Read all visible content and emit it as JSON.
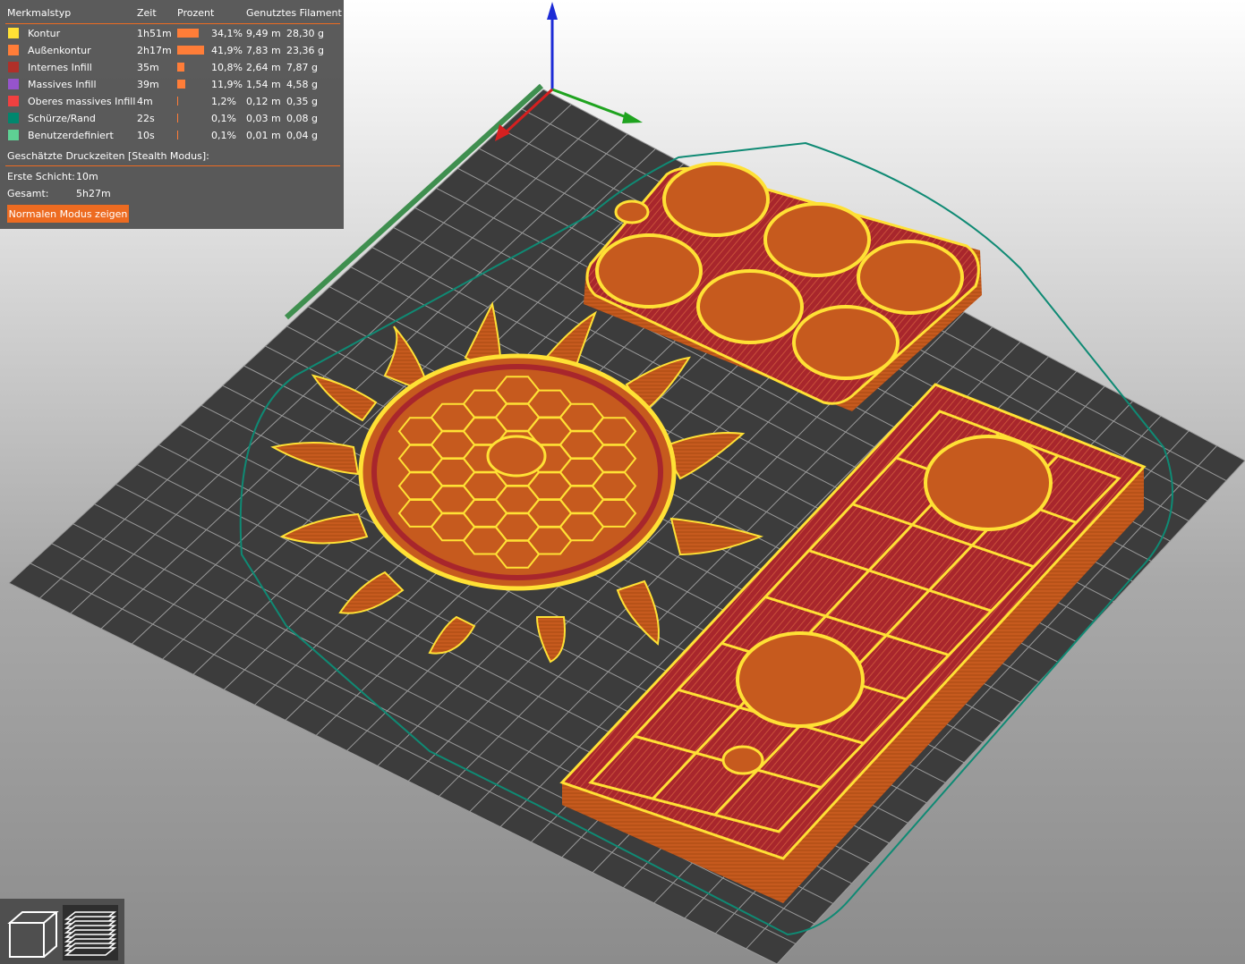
{
  "legend": {
    "headers": {
      "feature_type": "Merkmalstyp",
      "time": "Zeit",
      "percent": "Prozent",
      "filament": "Genutztes Filament"
    },
    "rows": [
      {
        "name": "Kontur",
        "time": "1h51m",
        "percent": "34,1%",
        "percent_value": 34.1,
        "length": "9,49 m",
        "weight": "28,30 g",
        "color": "#ffe135"
      },
      {
        "name": "Außenkontur",
        "time": "2h17m",
        "percent": "41,9%",
        "percent_value": 41.9,
        "length": "7,83 m",
        "weight": "23,36 g",
        "color": "#ff7d38"
      },
      {
        "name": "Internes Infill",
        "time": "35m",
        "percent": "10,8%",
        "percent_value": 10.8,
        "length": "2,64 m",
        "weight": "7,87 g",
        "color": "#b03029"
      },
      {
        "name": "Massives Infill",
        "time": "39m",
        "percent": "11,9%",
        "percent_value": 11.9,
        "length": "1,54 m",
        "weight": "4,58 g",
        "color": "#9654cc"
      },
      {
        "name": "Oberes massives Infill",
        "time": "4m",
        "percent": "1,2%",
        "percent_value": 1.2,
        "length": "0,12 m",
        "weight": "0,35 g",
        "color": "#f04040"
      },
      {
        "name": "Schürze/Rand",
        "time": "22s",
        "percent": "0,1%",
        "percent_value": 0.1,
        "length": "0,03 m",
        "weight": "0,08 g",
        "color": "#00876e"
      },
      {
        "name": "Benutzerdefiniert",
        "time": "10s",
        "percent": "0,1%",
        "percent_value": 0.1,
        "length": "0,01 m",
        "weight": "0,04 g",
        "color": "#5ed194"
      }
    ],
    "bar_color": "#ff7d38",
    "estimated_title": "Geschätzte Druckzeiten [Stealth Modus]:",
    "first_layer_label": "Erste Schicht:",
    "first_layer_value": "10m",
    "total_label": "Gesamt:",
    "total_value": "5h27m",
    "mode_button": "Normalen Modus zeigen",
    "accent_color": "#ed6b21"
  },
  "view_buttons": [
    {
      "name": "3d-view-icon"
    },
    {
      "name": "layers-view-icon"
    }
  ],
  "scene": {
    "bed_color": "#3c3c3c",
    "grid_color": "#9a9a9a",
    "perimeter_color": "#ffe135",
    "external_perimeter_color": "#c2591d",
    "infill_color": "#a8262c",
    "skirt_color": "#00876e",
    "axis_colors": {
      "x": "#d62020",
      "y": "#1fa31f",
      "z": "#1c2bd6"
    }
  }
}
